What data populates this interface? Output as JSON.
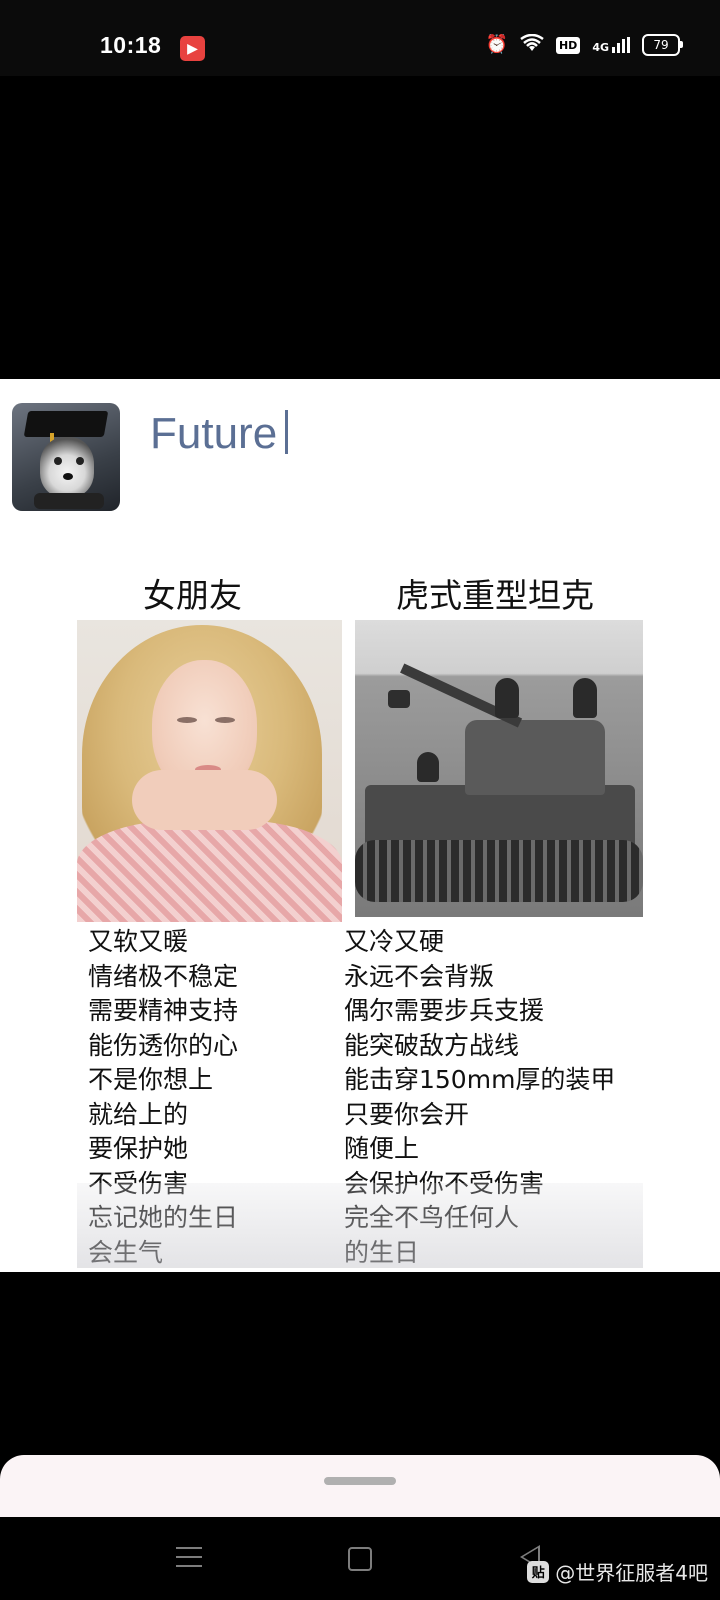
{
  "status_bar": {
    "time": "10:18",
    "app_badge_icon": "video-app-icon",
    "hd_label": "HD",
    "network_label": "4G",
    "battery": "79"
  },
  "post": {
    "author_title": "Future",
    "avatar_icon": "husky-graduate-avatar",
    "left_header": "女朋友",
    "right_header": "虎式重型坦克",
    "left_lines": [
      "又软又暖",
      "情绪极不稳定",
      "需要精神支持",
      "能伤透你的心",
      "不是你想上",
      "就给上的",
      "要保护她",
      "不受伤害",
      "忘记她的生日",
      "会生气"
    ],
    "right_lines": [
      "又冷又硬",
      "永远不会背叛",
      "偶尔需要步兵支援",
      "能突破敌方战线",
      "能击穿150mm厚的装甲",
      "只要你会开",
      "随便上",
      "会保护你不受伤害",
      "完全不鸟任何人",
      "的生日"
    ]
  },
  "watermark": {
    "logo_text": "贴",
    "text": "@世界征服者4吧"
  },
  "colors": {
    "author": "#5b6f94",
    "status_bg": "#0b0b0b",
    "sheet_bg": "#fbf4f6"
  }
}
